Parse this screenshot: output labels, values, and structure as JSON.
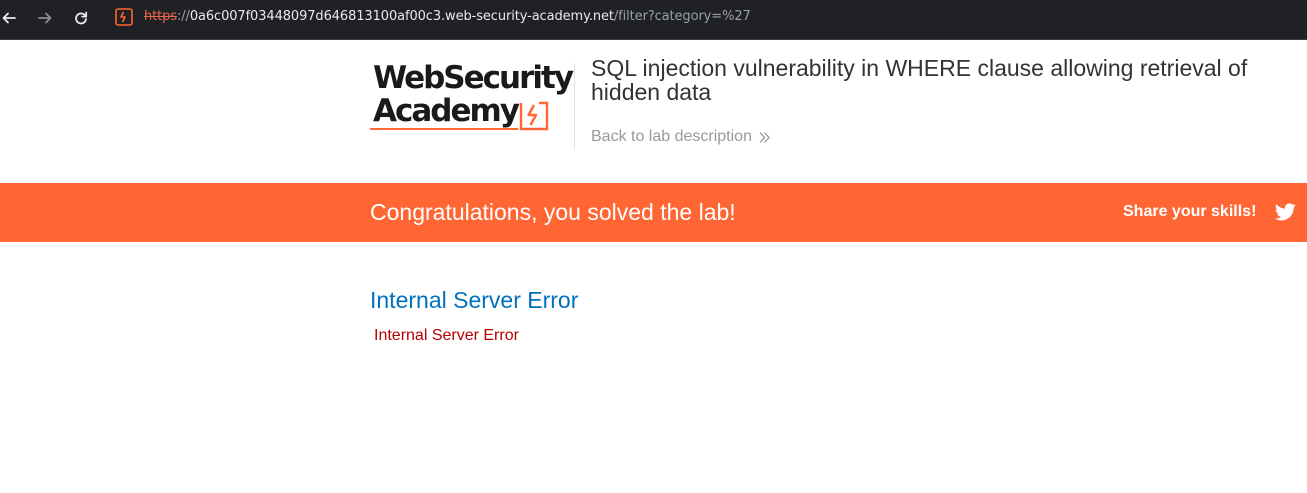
{
  "browser": {
    "url_scheme": "https",
    "url_separator": "://",
    "url_host": "0a6c007f03448097d646813100af00c3.web-security-academy.net",
    "url_path": "/filter?category=%27",
    "back_icon": "arrow-left-icon",
    "forward_icon": "arrow-right-icon",
    "reload_icon": "reload-icon",
    "site_icon": "web-security-academy-favicon"
  },
  "header": {
    "logo_line1": "WebSecurity",
    "logo_line2": "Academy",
    "lab_title": "SQL injection vulnerability in WHERE clause allowing retrieval of hidden data",
    "back_link": "Back to lab description",
    "back_link_icon": "double-chevron-right-icon"
  },
  "banner": {
    "message": "Congratulations, you solved the lab!",
    "share_label": "Share your skills!",
    "share_icon": "twitter-icon"
  },
  "main": {
    "heading": "Internal Server Error",
    "message": "Internal Server Error"
  },
  "colors": {
    "accent": "#ff6633",
    "heading_blue": "#0071bc",
    "error_red": "#b50000",
    "chrome_bg": "#202124"
  }
}
